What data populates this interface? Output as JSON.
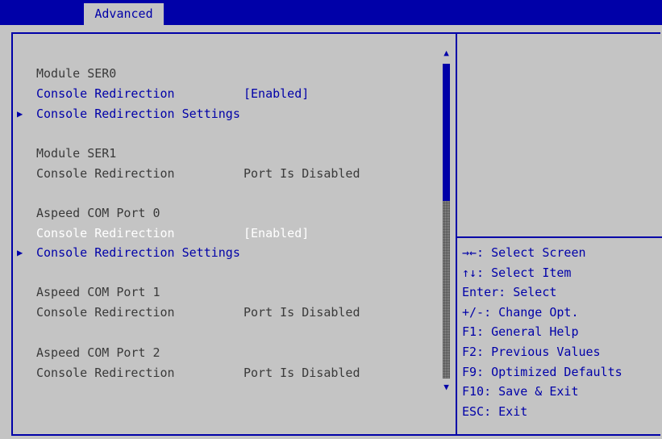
{
  "header": {
    "tab": "Advanced"
  },
  "items": [
    {
      "text": "Module SER0",
      "color": "gray"
    },
    {
      "label": "Console Redirection",
      "value": "[Enabled]",
      "color": "blue"
    },
    {
      "submenu": "Console Redirection Settings"
    },
    {
      "text": "Module SER1",
      "color": "gray"
    },
    {
      "label": "Console Redirection",
      "value": "Port Is Disabled",
      "color": "gray"
    },
    {
      "text": "Aspeed COM Port 0",
      "color": "gray"
    },
    {
      "label": "Console Redirection",
      "value": "[Enabled]",
      "color": "white"
    },
    {
      "submenu": "Console Redirection Settings"
    },
    {
      "text": "Aspeed COM Port 1",
      "color": "gray"
    },
    {
      "label": "Console Redirection",
      "value": "Port Is Disabled",
      "color": "gray"
    },
    {
      "text": "Aspeed COM Port 2",
      "color": "gray"
    },
    {
      "label": "Console Redirection",
      "value": "Port Is Disabled",
      "color": "gray"
    }
  ],
  "help": [
    "→←: Select Screen",
    "↑↓: Select Item",
    "Enter: Select",
    "+/-: Change Opt.",
    "F1: General Help",
    "F2: Previous Values",
    "F9: Optimized Defaults",
    "F10: Save & Exit",
    "ESC: Exit"
  ],
  "icons": {
    "submenu": "right-triangle-icon",
    "scroll_up": "up-triangle-icon",
    "scroll_down": "down-triangle-icon"
  },
  "colors": {
    "frame": "#0000a8",
    "background": "#c4c4c4",
    "text": "#3a3a3a",
    "highlight": "#ffffff"
  }
}
